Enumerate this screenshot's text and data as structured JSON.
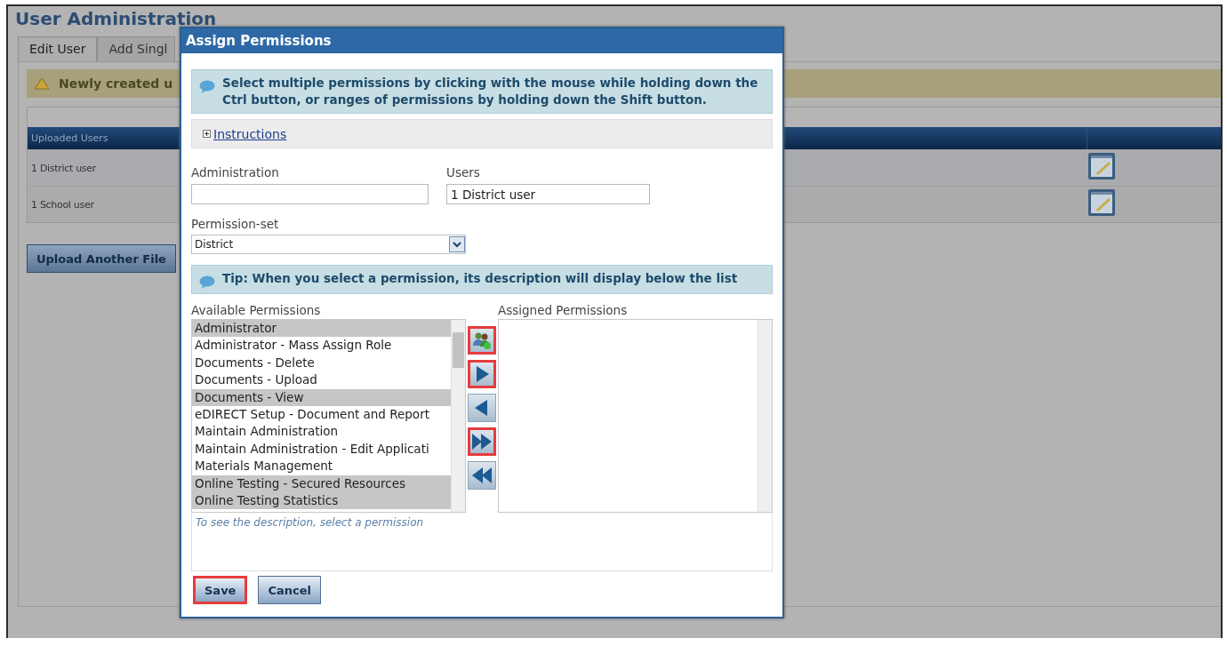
{
  "page": {
    "title": "User Administration",
    "tabs": [
      {
        "label": "Edit User",
        "selected": true
      },
      {
        "label": "Add Singl",
        "selected": false
      }
    ],
    "alert": {
      "text": "Newly created u"
    },
    "table": {
      "columns": [
        "Uploaded Users"
      ],
      "rows": [
        {
          "cells": [
            "1 District user"
          ]
        },
        {
          "cells": [
            "1 School user"
          ]
        }
      ]
    },
    "upload_button": "Upload Another File"
  },
  "dialog": {
    "title": "Assign Permissions",
    "info": "Select multiple permissions by clicking with the mouse while holding down the Ctrl button, or ranges of permissions by holding down the Shift button.",
    "instructions": {
      "label": "Instructions",
      "expanded": false
    },
    "administration": {
      "label": "Administration"
    },
    "users": {
      "label": "Users",
      "value": "1 District user"
    },
    "permission_set": {
      "label": "Permission-set",
      "value": "District"
    },
    "tip": "Tip: When you select a permission, its description will display below the list",
    "available": {
      "label": "Available Permissions",
      "items": [
        {
          "label": "Administrator",
          "selected": true
        },
        {
          "label": "Administrator - Mass Assign Role",
          "selected": false
        },
        {
          "label": "Documents - Delete",
          "selected": false
        },
        {
          "label": "Documents - Upload",
          "selected": false
        },
        {
          "label": "Documents - View",
          "selected": true
        },
        {
          "label": "eDIRECT Setup - Document and Report",
          "selected": false
        },
        {
          "label": "Maintain Administration",
          "selected": false
        },
        {
          "label": "Maintain Administration - Edit Applicati",
          "selected": false
        },
        {
          "label": "Materials Management",
          "selected": false
        },
        {
          "label": "Online Testing - Secured Resources",
          "selected": true
        },
        {
          "label": "Online Testing Statistics",
          "selected": true
        }
      ]
    },
    "assigned": {
      "label": "Assigned Permissions"
    },
    "move_buttons": [
      {
        "kind": "add-users",
        "highlighted": true
      },
      {
        "kind": "right",
        "highlighted": true
      },
      {
        "kind": "left",
        "highlighted": false
      },
      {
        "kind": "all-right",
        "highlighted": true
      },
      {
        "kind": "all-left",
        "highlighted": false
      }
    ],
    "description": "To see the description, select a permission",
    "buttons": [
      {
        "label": "Save",
        "highlighted": true
      },
      {
        "label": "Cancel",
        "highlighted": false
      }
    ]
  }
}
